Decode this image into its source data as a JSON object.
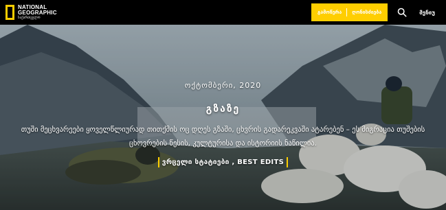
{
  "header": {
    "logo": {
      "line1": "NATIONAL",
      "line2": "GEOGRAPHIC",
      "sub": "საქართველო"
    },
    "nav_buttons": [
      "გამოწერა",
      "ღონისძიება"
    ],
    "menu_label": "მენიუ",
    "icons": {
      "search": "search-icon",
      "logo_frame": "yellow-frame-icon"
    },
    "colors": {
      "accent": "#ffce00",
      "bar": "#000000"
    }
  },
  "hero": {
    "date": "ოქტომბერი, 2020",
    "title": "გზაზე",
    "description": "თუში მეცხვარეები ყოველწლიურად თითქმის ოც დღეს გზაში, ცხვრის გადარეკვაში ატარებენ – ეს მიგრაცია თუშების ცხოვრების წესის, კულტურისა და ისტორიის ნაწილია.",
    "credits": "ვრცელი სტატიები , BEST EDITS"
  }
}
